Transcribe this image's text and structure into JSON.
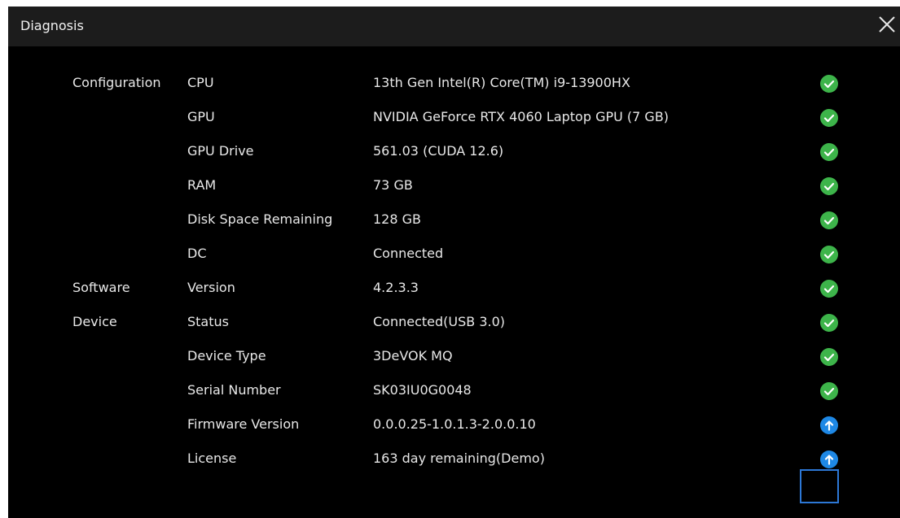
{
  "dialog": {
    "title": "Diagnosis",
    "close_icon": "close-icon",
    "colors": {
      "background": "#000000",
      "titlebar": "#1c1c1c",
      "text": "#e8e8e8",
      "ok": "#3db44a",
      "update": "#1e88e5",
      "highlight": "#2d78d6"
    }
  },
  "rows": [
    {
      "category": "Configuration",
      "item": "CPU",
      "value": "13th Gen Intel(R) Core(TM) i9-13900HX",
      "status": "ok"
    },
    {
      "category": "",
      "item": "GPU",
      "value": "NVIDIA GeForce RTX 4060 Laptop GPU (7 GB)",
      "status": "ok"
    },
    {
      "category": "",
      "item": "GPU Drive",
      "value": "561.03 (CUDA 12.6)",
      "status": "ok"
    },
    {
      "category": "",
      "item": "RAM",
      "value": "73 GB",
      "status": "ok"
    },
    {
      "category": "",
      "item": "Disk Space Remaining",
      "value": "128 GB",
      "status": "ok"
    },
    {
      "category": "",
      "item": "DC",
      "value": "Connected",
      "status": "ok"
    },
    {
      "category": "Software",
      "item": "Version",
      "value": "4.2.3.3",
      "status": "ok"
    },
    {
      "category": "Device",
      "item": "Status",
      "value": "Connected(USB 3.0)",
      "status": "ok"
    },
    {
      "category": "",
      "item": "Device Type",
      "value": "3DeVOK MQ",
      "status": "ok"
    },
    {
      "category": "",
      "item": "Serial Number",
      "value": "SK03IU0G0048",
      "status": "ok"
    },
    {
      "category": "",
      "item": "Firmware Version",
      "value": "0.0.0.25-1.0.1.3-2.0.0.10",
      "status": "update"
    },
    {
      "category": "",
      "item": "License",
      "value": "163 day remaining(Demo)",
      "status": "update"
    }
  ],
  "status_icons": {
    "ok": "check-circle-icon",
    "update": "arrow-up-circle-icon"
  }
}
